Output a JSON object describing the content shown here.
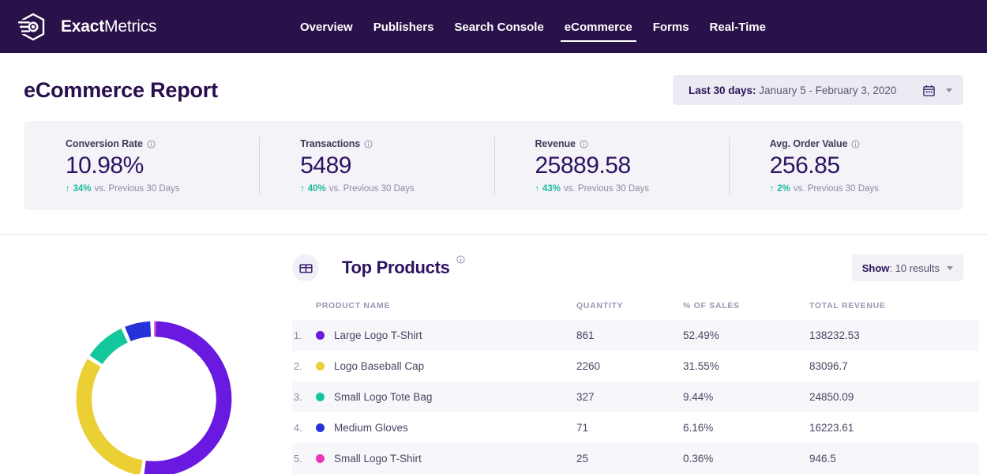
{
  "brand": {
    "bold": "Exact",
    "light": "Metrics",
    "logo_icon": "exactmetrics-logo-icon"
  },
  "nav": {
    "items": [
      {
        "label": "Overview",
        "active": false
      },
      {
        "label": "Publishers",
        "active": false
      },
      {
        "label": "Search Console",
        "active": false
      },
      {
        "label": "eCommerce",
        "active": true
      },
      {
        "label": "Forms",
        "active": false
      },
      {
        "label": "Real-Time",
        "active": false
      }
    ]
  },
  "header": {
    "title": "eCommerce Report",
    "daterange": {
      "prefix": "Last 30 days:",
      "value": " January 5 - February 3, 2020",
      "calendar_icon": "calendar-icon",
      "caret_icon": "chevron-down-icon"
    }
  },
  "kpis": [
    {
      "label": "Conversion Rate",
      "value": "10.98%",
      "delta": "34%",
      "delta_suffix": "vs. Previous 30 Days",
      "arrow": "↑"
    },
    {
      "label": "Transactions",
      "value": "5489",
      "delta": "40%",
      "delta_suffix": "vs. Previous 30 Days",
      "arrow": "↑"
    },
    {
      "label": "Revenue",
      "value": "25889.58",
      "delta": "43%",
      "delta_suffix": "vs. Previous 30 Days",
      "arrow": "↑"
    },
    {
      "label": "Avg. Order Value",
      "value": "256.85",
      "delta": "2%",
      "delta_suffix": "vs. Previous 30 Days",
      "arrow": "↑"
    }
  ],
  "products": {
    "icon": "box-icon",
    "title": "Top Products",
    "info_icon": "info-icon",
    "show": {
      "prefix": "Show",
      "value": ": 10 results",
      "caret_icon": "chevron-down-icon"
    },
    "columns": [
      "PRODUCT NAME",
      "QUANTITY",
      "% OF SALES",
      "TOTAL REVENUE"
    ],
    "rows": [
      {
        "index": "1.",
        "color": "#6919e0",
        "name": "Large Logo T-Shirt",
        "quantity": "861",
        "pct": "52.49%",
        "revenue": "138232.53"
      },
      {
        "index": "2.",
        "color": "#ead035",
        "name": "Logo Baseball Cap",
        "quantity": "2260",
        "pct": "31.55%",
        "revenue": "83096.7"
      },
      {
        "index": "3.",
        "color": "#13c79c",
        "name": "Small Logo Tote Bag",
        "quantity": "327",
        "pct": "9.44%",
        "revenue": "24850.09"
      },
      {
        "index": "4.",
        "color": "#2433d9",
        "name": "Medium Gloves",
        "quantity": "71",
        "pct": "6.16%",
        "revenue": "16223.61"
      },
      {
        "index": "5.",
        "color": "#e936b6",
        "name": "Small Logo T-Shirt",
        "quantity": "25",
        "pct": "0.36%",
        "revenue": "946.5"
      }
    ]
  },
  "chart_data": {
    "type": "pie",
    "title": "Top Products",
    "donut": true,
    "categories": [
      "Large Logo T-Shirt",
      "Logo Baseball Cap",
      "Small Logo Tote Bag",
      "Medium Gloves",
      "Small Logo T-Shirt"
    ],
    "values": [
      52.49,
      31.55,
      9.44,
      6.16,
      0.36
    ],
    "unit": "% of sales",
    "colors": [
      "#6919e0",
      "#ead035",
      "#13c79c",
      "#2433d9",
      "#e936b6"
    ],
    "start_angle": 0,
    "direction": "clockwise",
    "legend": "none",
    "gap_degrees": 3
  },
  "theme": {
    "nav_bg": "#29124a",
    "accent": "#6919e0",
    "positive": "#1eba9c",
    "card_bg": "#f4f3f8"
  }
}
